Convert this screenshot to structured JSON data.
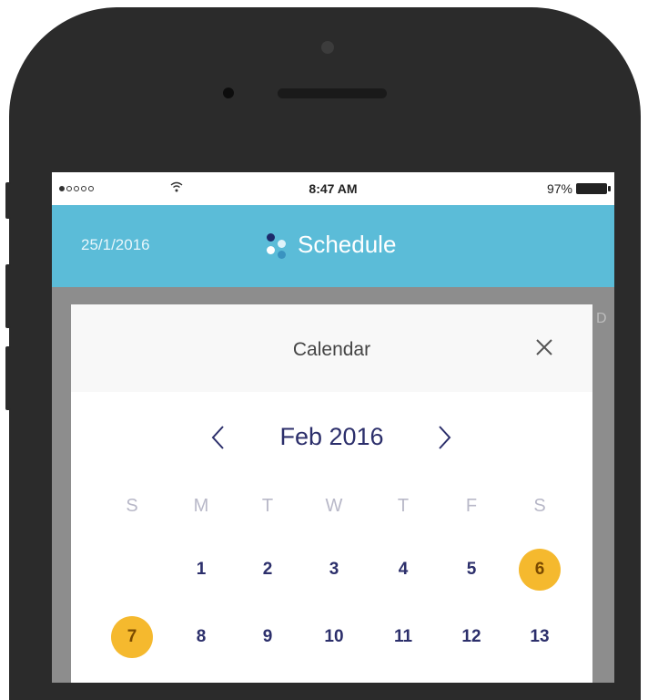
{
  "status_bar": {
    "time": "8:47 AM",
    "battery": "97%",
    "signal_dots": [
      true,
      false,
      false,
      false,
      false
    ]
  },
  "header": {
    "date_link": "25/1/2016",
    "app_title": "Schedule",
    "icon": "schedule-logo-icon",
    "color": "#5bbcd8"
  },
  "calendar": {
    "title": "Calendar",
    "close_icon": "close-icon",
    "month_label": "Feb 2016",
    "prev_icon": "chevron-left-icon",
    "next_icon": "chevron-right-icon",
    "weekdays": [
      "S",
      "M",
      "T",
      "W",
      "T",
      "F",
      "S"
    ],
    "weeks": [
      [
        "",
        "1",
        "2",
        "3",
        "4",
        "5",
        "6"
      ],
      [
        "7",
        "8",
        "9",
        "10",
        "11",
        "12",
        "13"
      ]
    ],
    "highlighted_days": [
      "6",
      "7"
    ],
    "highlight_color": "#f5b92e",
    "text_color": "#2c2f6b"
  }
}
